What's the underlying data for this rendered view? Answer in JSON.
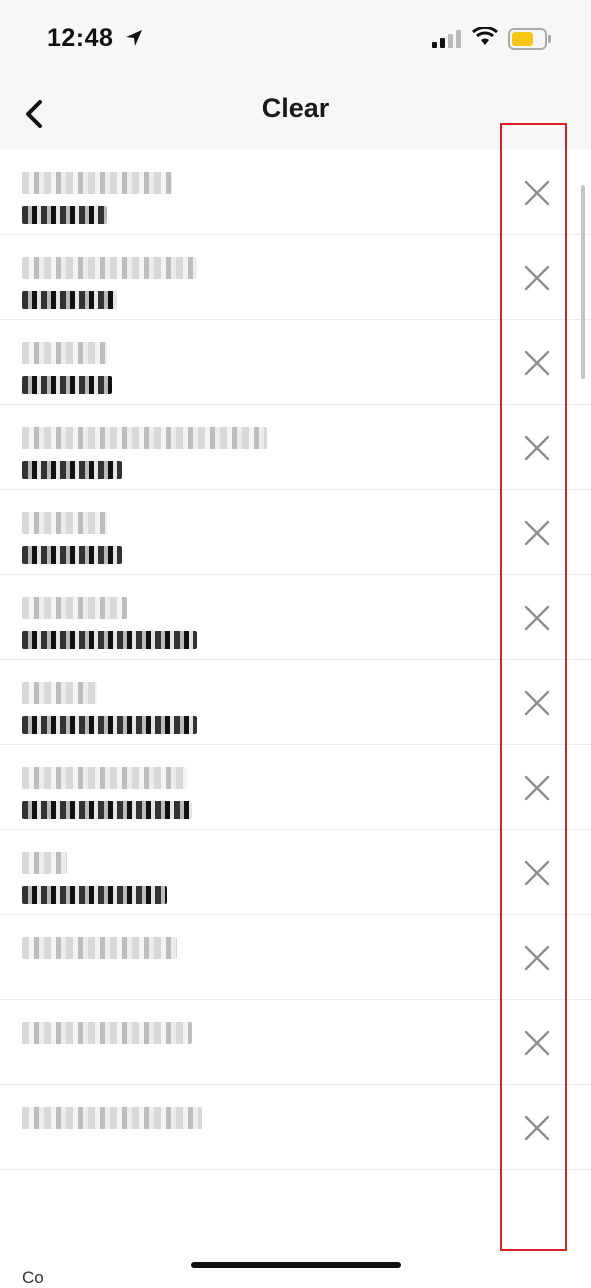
{
  "status": {
    "time": "12:48",
    "icons": [
      "location-arrow-icon",
      "cellular-signal-icon",
      "wifi-icon",
      "battery-icon"
    ],
    "battery_color": "#f5c518"
  },
  "nav": {
    "title": "Clear",
    "back_icon": "chevron-left-icon"
  },
  "rows": [
    {
      "name": "",
      "username": "",
      "clear_icon": "close-icon"
    },
    {
      "name": "",
      "username": "",
      "clear_icon": "close-icon"
    },
    {
      "name": "",
      "username": "",
      "clear_icon": "close-icon"
    },
    {
      "name": "",
      "username": "",
      "clear_icon": "close-icon"
    },
    {
      "name": "",
      "username": "",
      "clear_icon": "close-icon"
    },
    {
      "name": "",
      "username": "",
      "clear_icon": "close-icon"
    },
    {
      "name": "",
      "username": "",
      "clear_icon": "close-icon"
    },
    {
      "name": "",
      "username": "",
      "clear_icon": "close-icon"
    },
    {
      "name": "",
      "username": "",
      "clear_icon": "close-icon"
    },
    {
      "name": "",
      "username": "",
      "clear_icon": "close-icon"
    },
    {
      "name": "",
      "username": "",
      "clear_icon": "close-icon"
    },
    {
      "name": "",
      "username": "",
      "clear_icon": "close-icon"
    }
  ],
  "partial_row_text": "Co",
  "highlight_color": "#d9202b"
}
